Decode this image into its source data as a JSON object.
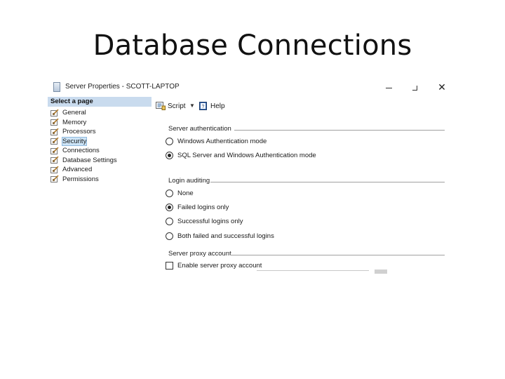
{
  "slide": {
    "title": "Database Connections"
  },
  "window": {
    "title": "Server Properties - SCOTT-LAPTOP",
    "close_glyph": "✕"
  },
  "left_pane": {
    "header": "Select a page",
    "items": [
      {
        "label": "General",
        "selected": false
      },
      {
        "label": "Memory",
        "selected": false
      },
      {
        "label": "Processors",
        "selected": false
      },
      {
        "label": "Security",
        "selected": true
      },
      {
        "label": "Connections",
        "selected": false
      },
      {
        "label": "Database Settings",
        "selected": false
      },
      {
        "label": "Advanced",
        "selected": false
      },
      {
        "label": "Permissions",
        "selected": false
      }
    ]
  },
  "toolbar": {
    "script_label": "Script",
    "dropdown_glyph": "▼",
    "help_label": "Help"
  },
  "server_authentication": {
    "header": "Server authentication",
    "options": [
      {
        "label": "Windows Authentication mode",
        "checked": false
      },
      {
        "label": "SQL Server and Windows Authentication mode",
        "checked": true
      }
    ]
  },
  "login_auditing": {
    "header": "Login auditing",
    "options": [
      {
        "label": "None",
        "checked": false
      },
      {
        "label": "Failed logins only",
        "checked": true
      },
      {
        "label": "Successful logins only",
        "checked": false
      },
      {
        "label": "Both failed and successful logins",
        "checked": false
      }
    ]
  },
  "server_proxy_account": {
    "header": "Server proxy account",
    "enable_label": "Enable server proxy account",
    "enabled": false
  },
  "colors": {
    "accent_header": "#c9dbee",
    "selection": "#cce4f7",
    "pane_background": "#f0f0f0"
  }
}
